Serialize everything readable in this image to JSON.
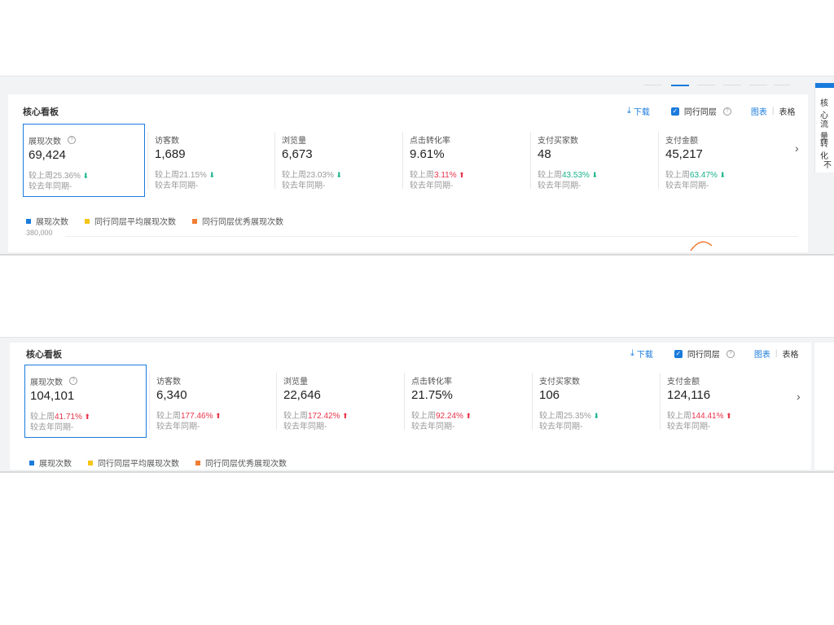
{
  "colors": {
    "primary": "#1a7bdc",
    "up": "#e8334a",
    "down": "#19b38c",
    "legend_blue": "#1a7bdc",
    "legend_yellow": "#f5c518",
    "legend_orange": "#f07d32"
  },
  "top": {
    "title": "核心看板",
    "download": "下载",
    "peer": "同行同层",
    "tab_chart": "图表",
    "tab_sep": "|",
    "tab_table": "表格",
    "metrics": [
      {
        "name": "展现次数",
        "value": "69,424",
        "wow_prefix": "较上周",
        "wow": "25.36%",
        "wow_dir": "down",
        "yoy": "较去年同期-"
      },
      {
        "name": "访客数",
        "value": "1,689",
        "wow_prefix": "较上周",
        "wow": "21.15%",
        "wow_dir": "down",
        "yoy": "较去年同期-"
      },
      {
        "name": "浏览量",
        "value": "6,673",
        "wow_prefix": "较上周",
        "wow": "23.03%",
        "wow_dir": "down",
        "yoy": "较去年同期-"
      },
      {
        "name": "点击转化率",
        "value": "9.61%",
        "wow_prefix": "较上周",
        "wow": "3.11%",
        "wow_dir": "up",
        "yoy": "较去年同期-"
      },
      {
        "name": "支付买家数",
        "value": "48",
        "wow_prefix": "较上周",
        "wow": "43.53%",
        "wow_dir": "down",
        "yoy": "较去年同期-"
      },
      {
        "name": "支付金额",
        "value": "45,217",
        "wow_prefix": "较上周",
        "wow": "63.47%",
        "wow_dir": "down",
        "yoy": "较去年同期-"
      }
    ],
    "legend": [
      "展现次数",
      "同行同层平均展现次数",
      "同行同层优秀展现次数"
    ],
    "y_tick": "380,000",
    "side_menu": [
      "核心",
      "流量",
      "转化",
      "不"
    ]
  },
  "bottom": {
    "title": "核心看板",
    "download": "下载",
    "peer": "同行同层",
    "tab_chart": "图表",
    "tab_sep": "|",
    "tab_table": "表格",
    "metrics": [
      {
        "name": "展现次数",
        "value": "104,101",
        "wow_prefix": "较上周",
        "wow": "41.71%",
        "wow_dir": "up",
        "yoy": "较去年同期-"
      },
      {
        "name": "访客数",
        "value": "6,340",
        "wow_prefix": "较上周",
        "wow": "177.46%",
        "wow_dir": "up",
        "yoy": "较去年同期-"
      },
      {
        "name": "浏览量",
        "value": "22,646",
        "wow_prefix": "较上周",
        "wow": "172.42%",
        "wow_dir": "up",
        "yoy": "较去年同期-"
      },
      {
        "name": "点击转化率",
        "value": "21.75%",
        "wow_prefix": "较上周",
        "wow": "92.24%",
        "wow_dir": "up",
        "yoy": "较去年同期-"
      },
      {
        "name": "支付买家数",
        "value": "106",
        "wow_prefix": "较上周",
        "wow": "25.35%",
        "wow_dir": "down",
        "yoy": "较去年同期-"
      },
      {
        "name": "支付金额",
        "value": "124,116",
        "wow_prefix": "较上周",
        "wow": "144.41%",
        "wow_dir": "up",
        "yoy": "较去年同期-"
      }
    ],
    "legend": [
      "展现次数",
      "同行同层平均展现次数",
      "同行同层优秀展现次数"
    ]
  }
}
